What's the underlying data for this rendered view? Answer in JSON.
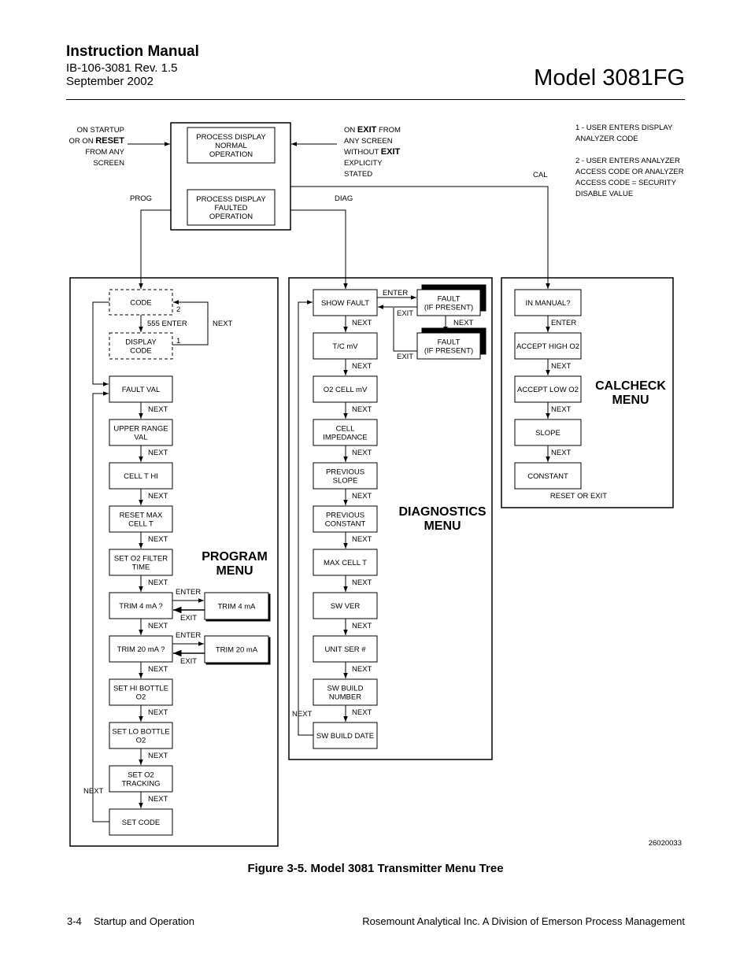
{
  "header": {
    "manual_title": "Instruction Manual",
    "doc_number": "IB-106-3081 Rev. 1.5",
    "date": "September 2002",
    "model": "Model 3081FG"
  },
  "diagram": {
    "top_box": {
      "normal": [
        "PROCESS DISPLAY",
        "NORMAL",
        "OPERATION"
      ],
      "faulted": [
        "PROCESS DISPLAY",
        "FAULTED",
        "OPERATION"
      ]
    },
    "left_note": [
      "ON STARTUP",
      "OR ON ",
      "RESET",
      "FROM ANY",
      "SCREEN"
    ],
    "right_note": [
      "ON ",
      "EXIT",
      " FROM",
      "ANY SCREEN",
      "WITHOUT ",
      "EXIT",
      "EXPLICITY",
      "STATED"
    ],
    "notes": [
      "1 - USER ENTERS DISPLAY",
      "ANALYZER CODE",
      "2 - USER ENTERS ANALYZER",
      "ACCESS CODE OR ANALYZER",
      "ACCESS CODE = SECURITY",
      "DISABLE VALUE"
    ],
    "branch_labels": {
      "prog": "PROG",
      "diag": "DIAG",
      "cal": "CAL"
    },
    "program_menu": {
      "title": [
        "PROGRAM",
        "MENU"
      ],
      "code": [
        "CODE"
      ],
      "display_code": [
        "DISPLAY",
        "CODE"
      ],
      "code_enter": "555 ENTER",
      "code_next": "NEXT",
      "code_mark_2": "2",
      "code_mark_1": "1",
      "items": [
        [
          "FAULT VAL"
        ],
        [
          "UPPER RANGE",
          "VAL"
        ],
        [
          "CELL  T  HI"
        ],
        [
          "RESET MAX",
          "CELL  T"
        ],
        [
          "SET O2 FILTER",
          "TIME"
        ],
        [
          "TRIM 4 mA ?"
        ],
        [
          "TRIM 20 mA ?"
        ],
        [
          "SET HI BOTTLE",
          "O2"
        ],
        [
          "SET LO BOTTLE",
          "O2"
        ],
        [
          "SET O2",
          "TRACKING"
        ],
        [
          "SET CODE"
        ]
      ],
      "next_label": "NEXT",
      "loop_label": "NEXT",
      "trim4": [
        "TRIM 4 mA"
      ],
      "trim20": [
        "TRIM 20 mA"
      ],
      "enter_label": "ENTER",
      "exit_label": "EXIT"
    },
    "diagnostics_menu": {
      "title": [
        "DIAGNOSTICS",
        "MENU"
      ],
      "items": [
        [
          "SHOW FAULT"
        ],
        [
          "T/C mV"
        ],
        [
          "O2 CELL mV"
        ],
        [
          "CELL",
          "IMPEDANCE"
        ],
        [
          "PREVIOUS",
          "SLOPE"
        ],
        [
          "PREVIOUS",
          "CONSTANT"
        ],
        [
          "MAX CELL  T"
        ],
        [
          "SW VER"
        ],
        [
          "UNIT SER #"
        ],
        [
          "SW BUILD",
          "NUMBER"
        ],
        [
          "SW BUILD DATE"
        ]
      ],
      "fault1": [
        "FAULT",
        "(IF PRESENT)"
      ],
      "fault2": [
        "FAULT",
        "(IF PRESENT)"
      ],
      "next_label": "NEXT",
      "loop_label": "NEXT",
      "enter_label": "ENTER",
      "exit_label": "EXIT"
    },
    "calcheck_menu": {
      "title": [
        "CALCHECK",
        "MENU"
      ],
      "items": [
        [
          "IN MANUAL?"
        ],
        [
          "ACCEPT HIGH O2"
        ],
        [
          "ACCEPT LOW O2"
        ],
        [
          "SLOPE"
        ],
        [
          "CONSTANT"
        ]
      ],
      "step_labels": [
        "ENTER",
        "NEXT",
        "NEXT",
        "NEXT"
      ],
      "end_label": "RESET OR EXIT"
    },
    "figure_id": "26020033"
  },
  "caption": "Figure 3-5.  Model 3081 Transmitter Menu Tree",
  "footer": {
    "page": "3-4",
    "section": "Startup and Operation",
    "company": "Rosemount Analytical Inc.    A Division of Emerson Process Management"
  }
}
